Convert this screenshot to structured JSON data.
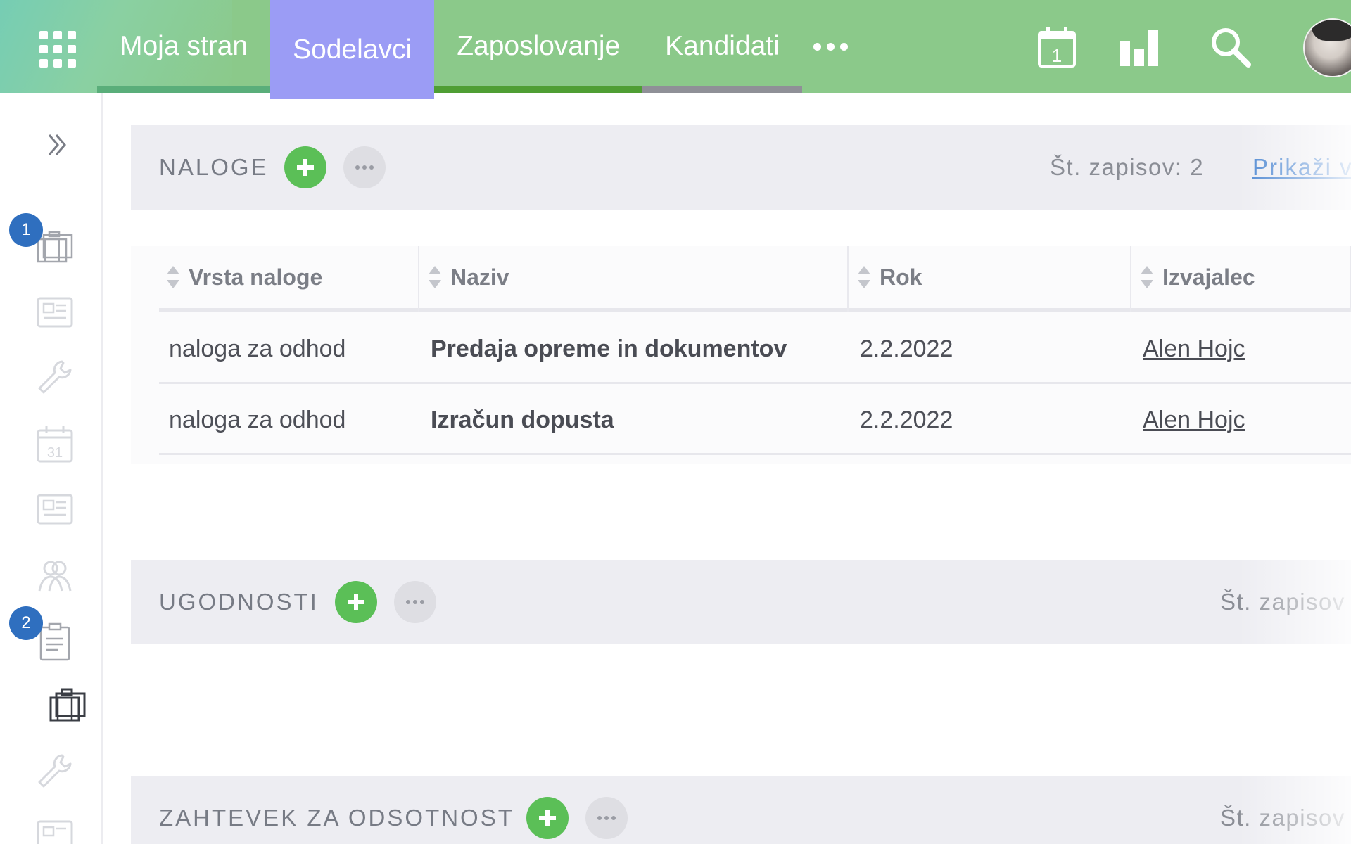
{
  "nav": {
    "items": [
      {
        "label": "Moja stran",
        "active": false,
        "bar_color": "#5aae7a"
      },
      {
        "label": "Sodelavci",
        "active": true,
        "bar_color": "#9b9cf5"
      },
      {
        "label": "Zaposlovanje",
        "active": false,
        "bar_color": "#4f9e34"
      },
      {
        "label": "Kandidati",
        "active": false,
        "bar_color": "#8f9097"
      }
    ],
    "calendar_day": "1",
    "icons": [
      "apps-grid-icon",
      "more-dots-icon",
      "calendar-icon",
      "bar-chart-icon",
      "search-icon",
      "avatar"
    ]
  },
  "sidebar": {
    "badges": [
      "1",
      "2"
    ],
    "icons": [
      "expand-chevrons-icon",
      "suitcase-icon",
      "document-icon",
      "wrench-icon",
      "calendar-31-icon",
      "document-icon",
      "people-icon",
      "clipboard-icon",
      "suitcase-icon",
      "wrench-icon",
      "document-icon"
    ],
    "calendar_day": "31"
  },
  "naloge": {
    "title": "NALOGE",
    "count": "Št. zapisov: 2",
    "link": "Prikaži v"
  },
  "table": {
    "columns": [
      "Vrsta naloge",
      "Naziv",
      "Rok",
      "Izvajalec"
    ],
    "rows": [
      [
        "naloga za odhod",
        "Predaja opreme in dokumentov",
        "2.2.2022",
        "Alen Hojc"
      ],
      [
        "naloga za odhod",
        "Izračun dopusta",
        "2.2.2022",
        "Alen Hojc"
      ]
    ]
  },
  "ugodnosti": {
    "title": "UGODNOSTI",
    "count": "Št. zapisov"
  },
  "odsotnost": {
    "title": "ZAHTEVEK ZA ODSOTNOST",
    "count": "Št. zapisov"
  },
  "colors": {
    "topbar": "#8bc98a",
    "active_tab": "#9b9cf5",
    "add_button": "#5bbf57",
    "badge": "#2f6fbf",
    "link": "#4c86d1"
  }
}
